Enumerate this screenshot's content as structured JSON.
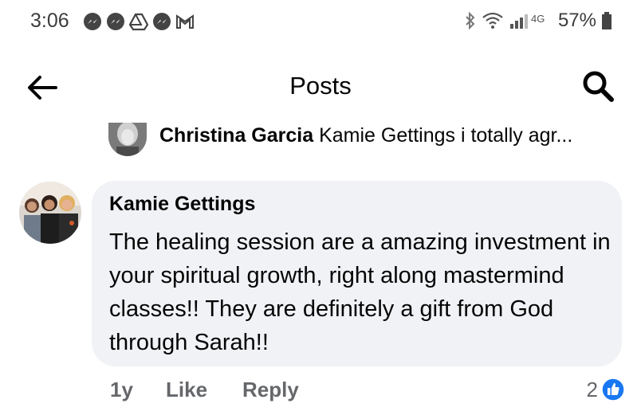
{
  "status_bar": {
    "time": "3:06",
    "network": "4G",
    "battery_percent": "57%",
    "notification_icons": [
      "messenger-icon",
      "messenger-icon",
      "drive-icon",
      "messenger-icon",
      "gmail-icon"
    ],
    "system_icons": [
      "bluetooth-icon",
      "wifi-icon",
      "signal-icon",
      "battery-icon"
    ]
  },
  "top_bar": {
    "title": "Posts",
    "back_icon": "arrow-left-icon",
    "search_icon": "search-icon"
  },
  "previous_reply": {
    "author": "Christina Garcia",
    "text": "Kamie Gettings i totally agr..."
  },
  "comment": {
    "author": "Kamie Gettings",
    "body": "The healing session are a amazing investment in your spiritual growth, right along mastermind classes!! They are definitely a gift from God through Sarah!!",
    "time_ago": "1y",
    "like_label": "Like",
    "reply_label": "Reply",
    "reaction_count": "2",
    "reaction_icon": "thumbs-up-icon"
  },
  "colors": {
    "bubble_bg": "#f0f2f5",
    "secondary_text": "#65676b",
    "like_blue": "#1877f2"
  }
}
